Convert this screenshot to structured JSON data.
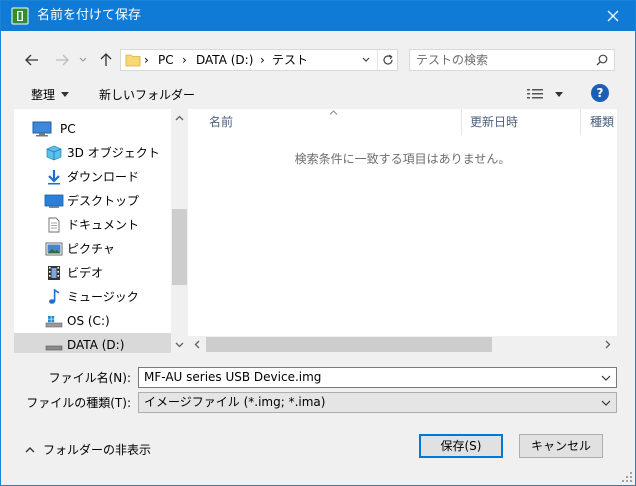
{
  "window": {
    "title": "名前を付けて保存",
    "colors": {
      "titlebar": "#0f7bd6",
      "accent": "#1883d7",
      "selected": "#d9d9d9"
    }
  },
  "address": {
    "segments": [
      "PC",
      "DATA (D:)",
      "テスト"
    ]
  },
  "search": {
    "placeholder": "テストの検索"
  },
  "toolbar": {
    "organize": "整理",
    "new_folder": "新しいフォルダー"
  },
  "nav": {
    "items": [
      {
        "label": "PC",
        "icon": "pc-icon"
      },
      {
        "label": "3D オブジェクト",
        "icon": "3d-objects-icon"
      },
      {
        "label": "ダウンロード",
        "icon": "download-icon"
      },
      {
        "label": "デスクトップ",
        "icon": "desktop-icon"
      },
      {
        "label": "ドキュメント",
        "icon": "document-icon"
      },
      {
        "label": "ピクチャ",
        "icon": "picture-icon"
      },
      {
        "label": "ビデオ",
        "icon": "video-icon"
      },
      {
        "label": "ミュージック",
        "icon": "music-icon"
      },
      {
        "label": "OS (C:)",
        "icon": "drive-os-icon"
      },
      {
        "label": "DATA (D:)",
        "icon": "drive-icon",
        "selected": true
      }
    ]
  },
  "filelist": {
    "columns": [
      "名前",
      "更新日時",
      "種類"
    ],
    "empty_message": "検索条件に一致する項目はありません。"
  },
  "form": {
    "filename_label": "ファイル名(N):",
    "filename_value": "MF-AU series USB Device.img",
    "filetype_label": "ファイルの種類(T):",
    "filetype_value": "イメージファイル (*.img; *.ima)"
  },
  "footer": {
    "hide_folders": "フォルダーの非表示",
    "save": "保存(S)",
    "cancel": "キャンセル"
  }
}
